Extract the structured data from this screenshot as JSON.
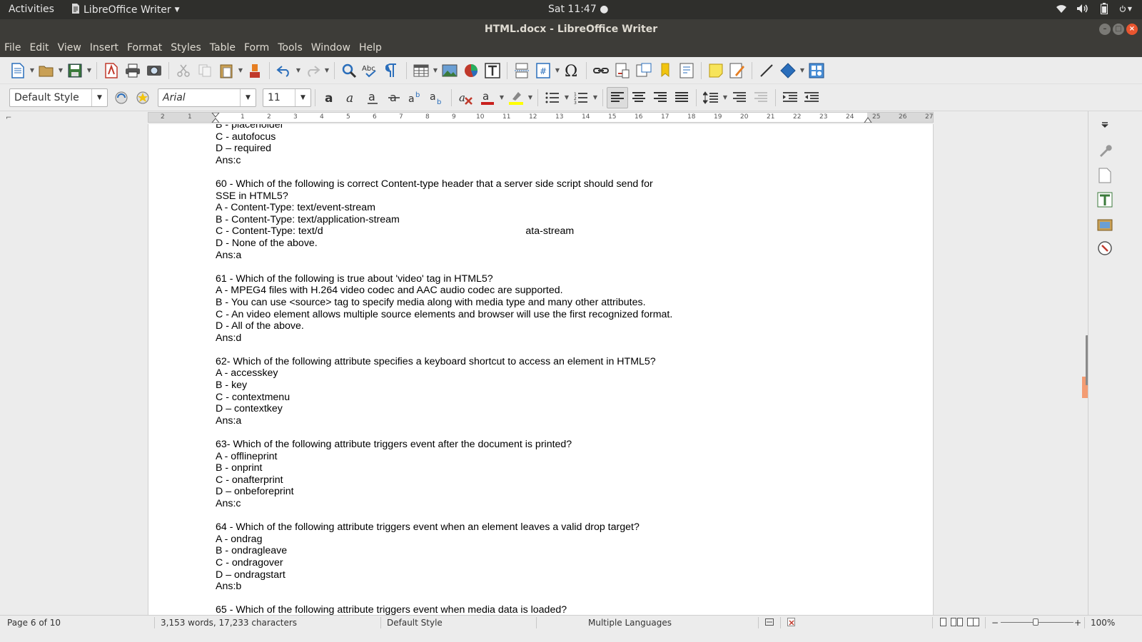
{
  "topbar": {
    "activities": "Activities",
    "app_name": "LibreOffice Writer",
    "clock": "Sat 11:47 ●",
    "tray_icons": [
      "wifi-icon",
      "volume-icon",
      "battery-icon",
      "power-icon"
    ]
  },
  "window": {
    "title": "HTML.docx - LibreOffice Writer",
    "buttons": [
      "minimize",
      "maximize",
      "close"
    ]
  },
  "menubar": {
    "items": [
      "File",
      "Edit",
      "View",
      "Insert",
      "Format",
      "Styles",
      "Table",
      "Form",
      "Tools",
      "Window",
      "Help"
    ]
  },
  "toolbar2": {
    "paragraph_style": "Default Style",
    "font_name": "Arial",
    "font_size": "11"
  },
  "ruler": {
    "ticks": [
      "2",
      "1",
      "1",
      "2",
      "3",
      "4",
      "5",
      "6",
      "7",
      "8",
      "9",
      "10",
      "11",
      "12",
      "13",
      "14",
      "15",
      "16",
      "17",
      "18",
      "19",
      "20",
      "21",
      "22",
      "23",
      "24",
      "25",
      "26",
      "27"
    ]
  },
  "document": {
    "blocks": [
      [
        "B - placeholder",
        "C - autofocus",
        "D – required",
        "Ans:c"
      ],
      [
        "60 - Which of the following is correct Content-type header that a server side script should send for",
        "SSE in HTML5?",
        "A - Content-Type: text/event-stream",
        "B - Content-Type: text/application-stream",
        "C - Content-Type: text/d                                                                        ata-stream",
        "D - None of the above.",
        "Ans:a"
      ],
      [
        "61 - Which of the following is true about 'video' tag in HTML5?",
        "A - MPEG4 files with H.264 video codec and AAC audio codec are supported.",
        "B - You can use <source> tag to specify media along with media type and many other attributes.",
        "C - An video element allows multiple source elements and browser will use the first recognized format.",
        "D - All of the above.",
        "Ans:d"
      ],
      [
        "62- Which of the following attribute specifies a keyboard shortcut to access an element in HTML5?",
        "A - accesskey",
        "B - key",
        "C - contextmenu",
        "D – contextkey",
        "Ans:a"
      ],
      [
        "63- Which of the following attribute triggers event after the document is printed?",
        "A - offlineprint",
        "B - onprint",
        "C - onafterprint",
        "D – onbeforeprint",
        "Ans:c"
      ],
      [
        "64 - Which of the following attribute triggers event when an element leaves a valid drop target?",
        "A - ondrag",
        "B - ondragleave",
        "C - ondragover",
        "D – ondragstart",
        "Ans:b"
      ],
      [
        "65 - Which of the following attribute triggers event when media data is loaded?"
      ]
    ]
  },
  "statusbar": {
    "page": "Page 6 of 10",
    "words": "3,153 words, 17,233 characters",
    "style": "Default Style",
    "language": "Multiple Languages",
    "zoom": "100%",
    "zoom_minus": "−",
    "zoom_plus": "+"
  },
  "colors": {
    "topbar_bg": "#2f2f2c",
    "titlebar_bg": "#3d3c38",
    "close_button": "#e9552f",
    "scroll_thumb": "#f39c73",
    "toolbar_bg": "#ececec"
  }
}
